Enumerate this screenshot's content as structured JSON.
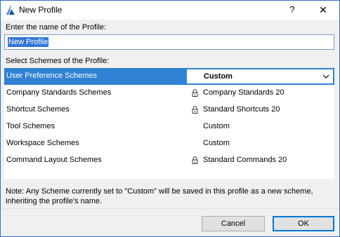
{
  "window": {
    "title": "New Profile",
    "help_glyph": "?",
    "close_glyph": "✕"
  },
  "name_section": {
    "label": "Enter the name of the Profile:",
    "value": "New Profile"
  },
  "schemes_section": {
    "label": "Select Schemes of the Profile:",
    "rows": [
      {
        "name": "User Preference Schemes",
        "value": "Custom",
        "locked": false,
        "selected": true
      },
      {
        "name": "Company Standards Schemes",
        "value": "Company Standards 20",
        "locked": true,
        "selected": false
      },
      {
        "name": "Shortcut Schemes",
        "value": "Standard Shortcuts 20",
        "locked": true,
        "selected": false
      },
      {
        "name": "Tool Schemes",
        "value": "Custom",
        "locked": false,
        "selected": false
      },
      {
        "name": "Workspace Schemes",
        "value": "Custom",
        "locked": false,
        "selected": false
      },
      {
        "name": "Command Layout Schemes",
        "value": "Standard Commands 20",
        "locked": true,
        "selected": false
      }
    ]
  },
  "note": "Note: Any Scheme currently set to \"Custom\" will be saved in this profile as a new scheme, inheriting the profile's name.",
  "buttons": {
    "cancel": "Cancel",
    "ok": "OK"
  },
  "colors": {
    "selection": "#2f82d4",
    "text_selection": "#3377d6",
    "window_border": "#2f6fc8",
    "dialog_bg": "#f0f0f0"
  },
  "icons": {
    "app": "archicad-logo-icon",
    "lock": "lock-icon",
    "dropdown": "chevron-down-icon"
  }
}
